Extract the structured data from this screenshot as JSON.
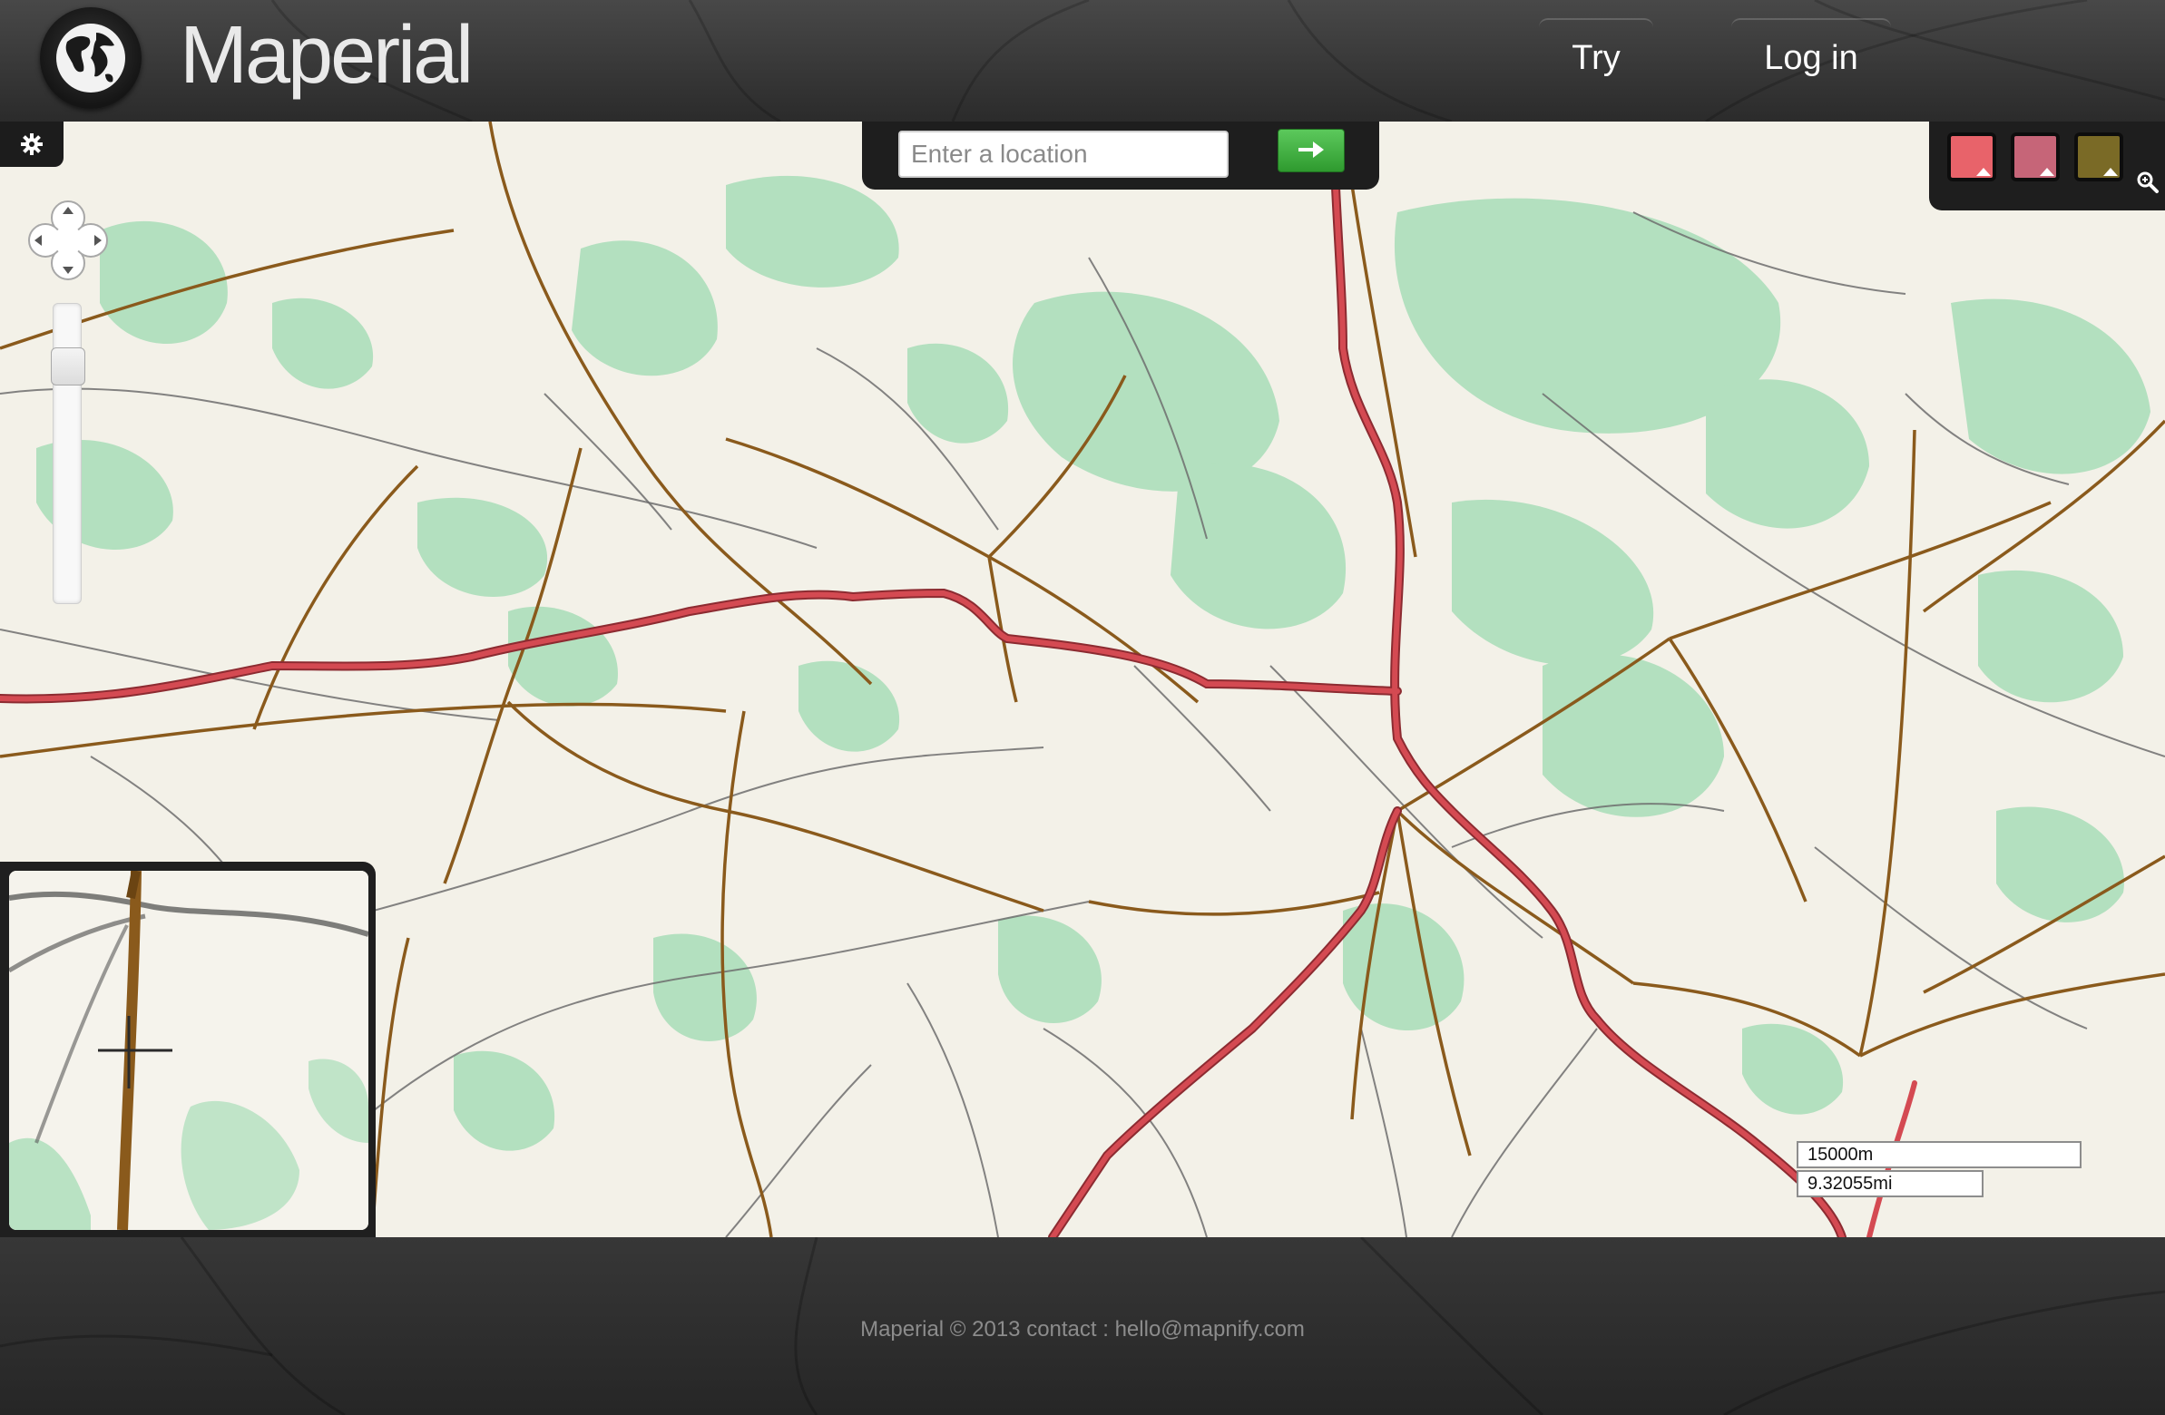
{
  "header": {
    "brand": "Maperial",
    "nav": {
      "try_label": "Try",
      "login_label": "Log in"
    }
  },
  "map": {
    "search": {
      "placeholder": "Enter a location",
      "value": ""
    },
    "style_swatches": [
      {
        "name": "roads-red",
        "color": "#e8636a"
      },
      {
        "name": "roads-pink",
        "color": "#c66578"
      },
      {
        "name": "roads-olive",
        "color": "#7a6a26"
      }
    ],
    "scale": {
      "meters": "15000m",
      "miles": "9.32055mi"
    }
  },
  "colors": {
    "background": "#f3f1e8",
    "forest": "#b3e0bf",
    "highway": "#d44a52",
    "main_road": "#8a5a1c",
    "minor_road": "#6d6d6d",
    "go_button": "#3ba83b"
  },
  "footer": {
    "text": "Maperial © 2013 contact : hello@mapnify.com"
  }
}
